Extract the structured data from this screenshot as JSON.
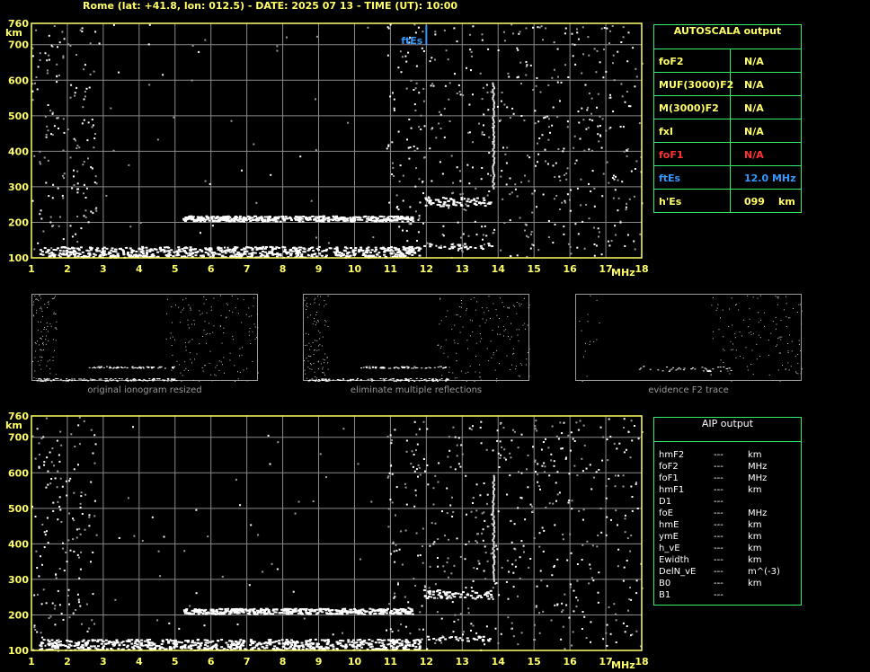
{
  "header": {
    "title": "Rome (lat: +41.8, lon: 012.5) - DATE: 2025 07 13 - TIME (UT): 10:00"
  },
  "colors": {
    "axis": "#ffff66",
    "grid": "#8a8a8a",
    "panel_border": "#33ee66",
    "foF1": "#ff3333",
    "ftEs": "#3399ff",
    "echo": "#ffffff"
  },
  "chart_data": [
    {
      "type": "scatter",
      "name": "main-ionogram",
      "xlabel": "MHz",
      "ylabel": "km",
      "xlim": [
        1,
        18
      ],
      "ylim": [
        100,
        760
      ],
      "xticks": [
        "1",
        "2",
        "3",
        "4",
        "5",
        "6",
        "7",
        "8",
        "9",
        "10",
        "11",
        "12",
        "13",
        "14",
        "15",
        "16",
        "17",
        "18"
      ],
      "yticks": [
        "100",
        "200",
        "300",
        "400",
        "500",
        "600",
        "700",
        "760"
      ],
      "grid": true,
      "annotation": {
        "label": "ftEs",
        "x": 12.0
      },
      "traces": [
        {
          "x_start": 1.2,
          "x_end": 11.8,
          "y": 118,
          "thickness": 12,
          "density": "strong"
        },
        {
          "x_start": 5.2,
          "x_end": 11.6,
          "y": 212,
          "thickness": 6,
          "density": "strong"
        },
        {
          "x_start": 11.9,
          "x_end": 13.8,
          "y": 260,
          "thickness": 10,
          "density": "medium"
        },
        {
          "x_start": 11.9,
          "x_end": 13.8,
          "y": 135,
          "thickness": 6,
          "density": "light"
        }
      ],
      "noise_bands": [
        {
          "x_start": 1.0,
          "x_end": 2.8,
          "density": 0.12
        },
        {
          "x_start": 10.9,
          "x_end": 18.0,
          "density": 0.1
        },
        {
          "x_start": 2.8,
          "x_end": 10.9,
          "density": 0.008
        }
      ]
    },
    {
      "type": "scatter",
      "name": "aip-ionogram",
      "xlabel": "MHz",
      "ylabel": "km",
      "xlim": [
        1,
        18
      ],
      "ylim": [
        100,
        760
      ],
      "xticks": [
        "1",
        "2",
        "3",
        "4",
        "5",
        "6",
        "7",
        "8",
        "9",
        "10",
        "11",
        "12",
        "13",
        "14",
        "15",
        "16",
        "17",
        "18"
      ],
      "yticks": [
        "100",
        "200",
        "300",
        "400",
        "500",
        "600",
        "700",
        "760"
      ],
      "grid": true
    }
  ],
  "thumbnails": [
    {
      "caption": "original ionogram resized"
    },
    {
      "caption": "eliminate multiple reflections"
    },
    {
      "caption": "evidence F2 trace"
    }
  ],
  "autoscala": {
    "title": "AUTOSCALA output",
    "rows": [
      {
        "key": "foF2",
        "value": "N/A",
        "unit": "",
        "color": "#ffff66"
      },
      {
        "key": "MUF(3000)F2",
        "value": "N/A",
        "unit": "",
        "color": "#ffff66"
      },
      {
        "key": "M(3000)F2",
        "value": "N/A",
        "unit": "",
        "color": "#ffff66"
      },
      {
        "key": "fxI",
        "value": "N/A",
        "unit": "",
        "color": "#ffff66"
      },
      {
        "key": "foF1",
        "value": "N/A",
        "unit": "",
        "color": "#ff3333"
      },
      {
        "key": "ftEs",
        "value": "12.0 MHz",
        "unit": "",
        "color": "#3399ff"
      },
      {
        "key": "h'Es",
        "value": "099",
        "unit": "km",
        "color": "#ffff66"
      }
    ]
  },
  "aip": {
    "title": "AIP output",
    "rows": [
      {
        "key": "hmF2",
        "value": "---",
        "unit": "km"
      },
      {
        "key": "foF2",
        "value": "---",
        "unit": "MHz"
      },
      {
        "key": "foF1",
        "value": "---",
        "unit": "MHz"
      },
      {
        "key": "hmF1",
        "value": "---",
        "unit": "km"
      },
      {
        "key": "D1",
        "value": "---",
        "unit": ""
      },
      {
        "key": "foE",
        "value": "---",
        "unit": "MHz"
      },
      {
        "key": "hmE",
        "value": "---",
        "unit": "km"
      },
      {
        "key": "ymE",
        "value": "---",
        "unit": "km"
      },
      {
        "key": "h_vE",
        "value": "---",
        "unit": "km"
      },
      {
        "key": "Ewidth",
        "value": "---",
        "unit": "km"
      },
      {
        "key": "DelN_vE",
        "value": "---",
        "unit": "m^(-3)"
      },
      {
        "key": "B0",
        "value": "---",
        "unit": "km"
      },
      {
        "key": "B1",
        "value": "---",
        "unit": ""
      }
    ]
  }
}
